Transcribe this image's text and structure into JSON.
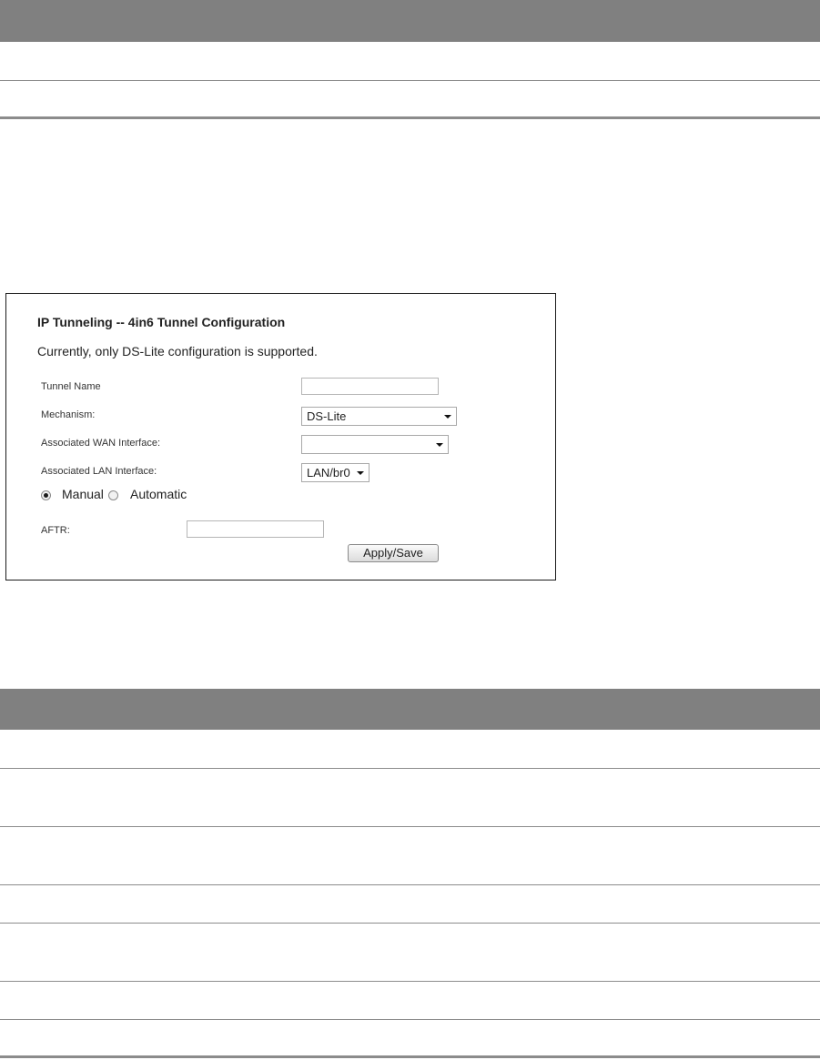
{
  "screenshot": {
    "title": "IP Tunneling -- 4in6 Tunnel Configuration",
    "subtitle": "Currently, only DS-Lite configuration is supported.",
    "fields": {
      "tunnel_name_label": "Tunnel Name",
      "tunnel_name_value": "",
      "mechanism_label": "Mechanism:",
      "mechanism_value": "DS-Lite",
      "wan_label": "Associated WAN Interface:",
      "wan_value": "",
      "lan_label": "Associated LAN Interface:",
      "lan_value": "LAN/br0",
      "aftr_label": "AFTR:",
      "aftr_value": ""
    },
    "radios": {
      "manual_label": "Manual",
      "automatic_label": "Automatic",
      "selected": "Manual"
    },
    "apply_button": "Apply/Save"
  }
}
